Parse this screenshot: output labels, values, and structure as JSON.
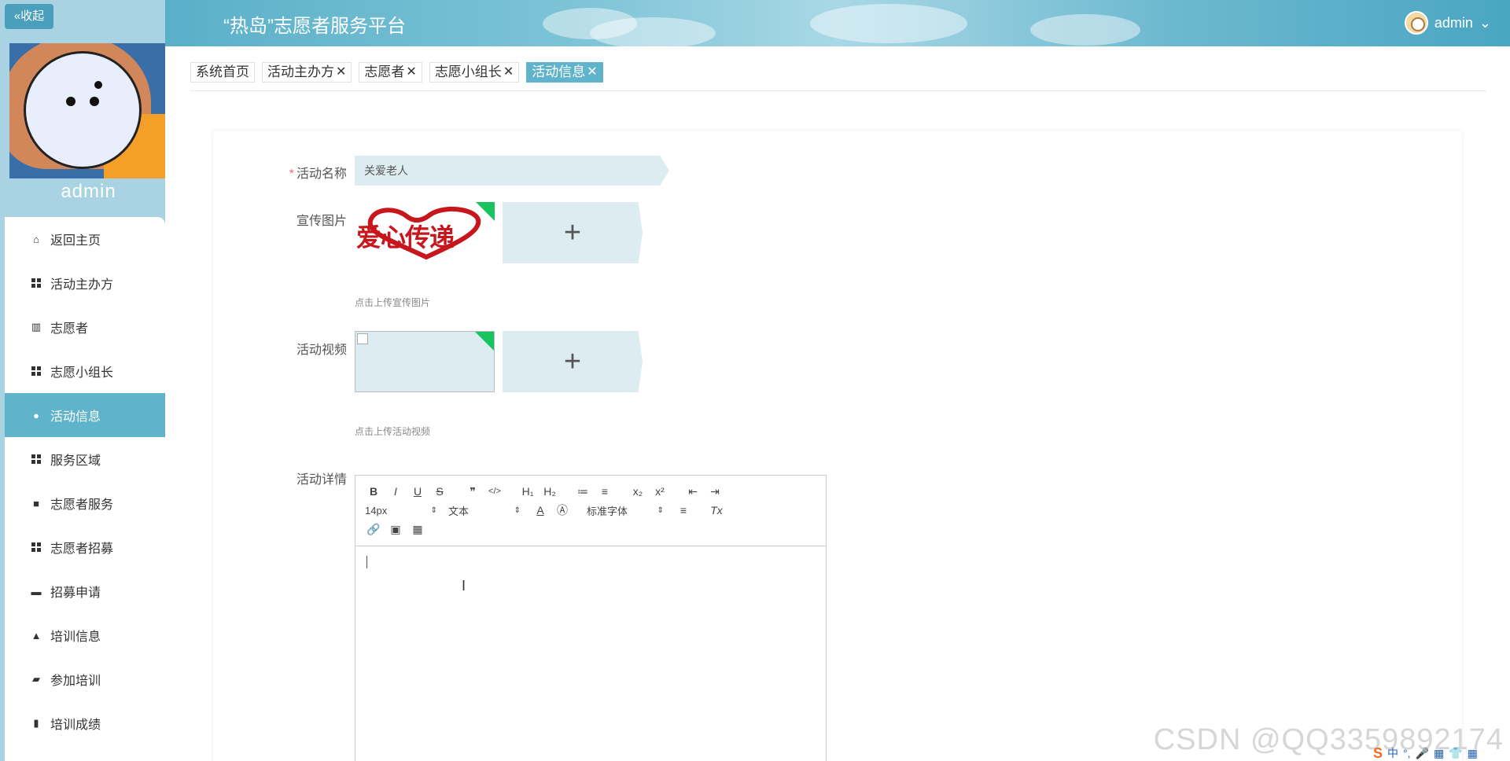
{
  "header": {
    "collapse_label": "«收起",
    "app_title": "“热岛”志愿者服务平台",
    "user_name": "admin",
    "user_caret": "⌄"
  },
  "sidebar": {
    "profile_name": "admin",
    "items": [
      {
        "label": "返回主页",
        "icon": "home-icon"
      },
      {
        "label": "活动主办方",
        "icon": "grid-icon"
      },
      {
        "label": "志愿者",
        "icon": "book-icon"
      },
      {
        "label": "志愿小组长",
        "icon": "grid-icon"
      },
      {
        "label": "活动信息",
        "icon": "pin-icon",
        "active": true
      },
      {
        "label": "服务区域",
        "icon": "grid-icon"
      },
      {
        "label": "志愿者服务",
        "icon": "video-icon"
      },
      {
        "label": "志愿者招募",
        "icon": "grid-icon"
      },
      {
        "label": "招募申请",
        "icon": "briefcase-icon"
      },
      {
        "label": "培训信息",
        "icon": "user-icon"
      },
      {
        "label": "参加培训",
        "icon": "chat-icon"
      },
      {
        "label": "培训成绩",
        "icon": "clipboard-icon"
      }
    ]
  },
  "tabs": [
    {
      "label": "系统首页",
      "closable": false
    },
    {
      "label": "活动主办方",
      "closable": true
    },
    {
      "label": "志愿者",
      "closable": true
    },
    {
      "label": "志愿小组长",
      "closable": true
    },
    {
      "label": "活动信息",
      "closable": true,
      "active": true
    }
  ],
  "form": {
    "name_label": "活动名称",
    "name_required": "*",
    "name_value": "关爱老人",
    "image_label": "宣传图片",
    "image_logo_text": "爱心传递",
    "image_hint": "点击上传宣传图片",
    "video_label": "活动视频",
    "video_hint": "点击上传活动视频",
    "detail_label": "活动详情",
    "upload_plus": "+"
  },
  "editor": {
    "row1": [
      "B",
      "I",
      "U",
      "S",
      "❞",
      "</>",
      "H₁",
      "H₂",
      "≔",
      "≡",
      "x₂",
      "x²",
      "⇤",
      "⇥"
    ],
    "size_select": "14px",
    "type_select": "文本",
    "font_select": "标准字体",
    "row2_icons": [
      "A",
      "Ⓐ",
      "≡",
      "Tx"
    ],
    "row3_icons": [
      "🔗",
      "▣",
      "▦"
    ]
  },
  "watermark": "CSDN @QQ3359892174",
  "ime": {
    "logo": "S",
    "items": [
      "中",
      "°,",
      "🎤",
      "▦",
      "👕",
      "▦"
    ]
  },
  "colors": {
    "accent": "#5fb3cb",
    "sidebar_bg": "#a9d3e2",
    "required": "#f56c6c",
    "upload_bg": "#dcecf1"
  }
}
